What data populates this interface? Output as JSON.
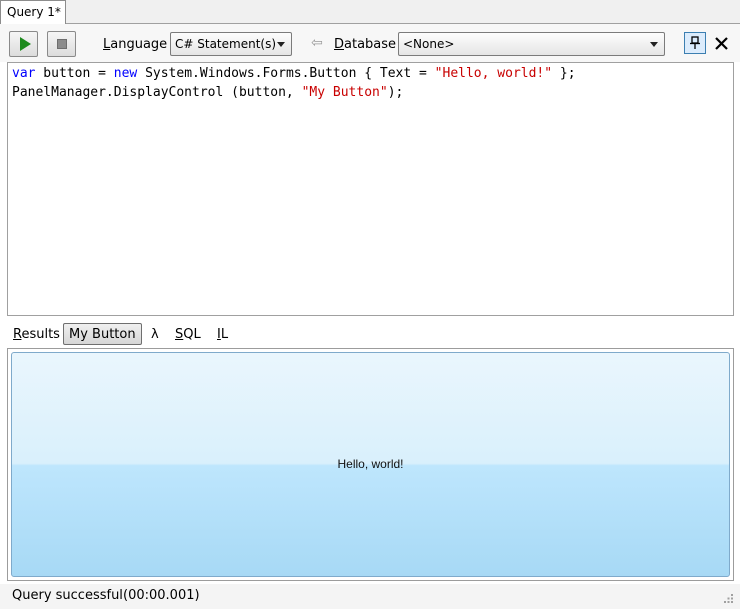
{
  "tab": {
    "title": "Query 1*"
  },
  "toolbar": {
    "language_label_prefix": "",
    "language_label_accel": "L",
    "language_label_rest": "anguage",
    "language_value": "C# Statement(s)",
    "database_label_accel": "D",
    "database_label_rest": "atabase",
    "database_value": "<None>"
  },
  "editor": {
    "line1": {
      "t1": "var",
      "t2": " button = ",
      "t3": "new",
      "t4": " System.Windows.Forms.Button { Text = ",
      "t5": "\"Hello, world!\"",
      "t6": " };"
    },
    "line2": {
      "t1": "PanelManager.DisplayControl (button, ",
      "t2": "\"My Button\"",
      "t3": ");"
    }
  },
  "results_tabs": {
    "results_accel": "R",
    "results_rest": "esults",
    "mybutton": "My Button",
    "lambda": "λ",
    "sql_accel": "S",
    "sql_rest": "QL",
    "il_accel": "I",
    "il_rest": "L"
  },
  "result": {
    "button_text": "Hello, world!"
  },
  "status": {
    "message": "Query successful",
    "elapsed": "(00:00.001)"
  },
  "colors": {
    "keyword": "#0000ff",
    "string": "#c80000",
    "run": "#1e8a1e"
  }
}
